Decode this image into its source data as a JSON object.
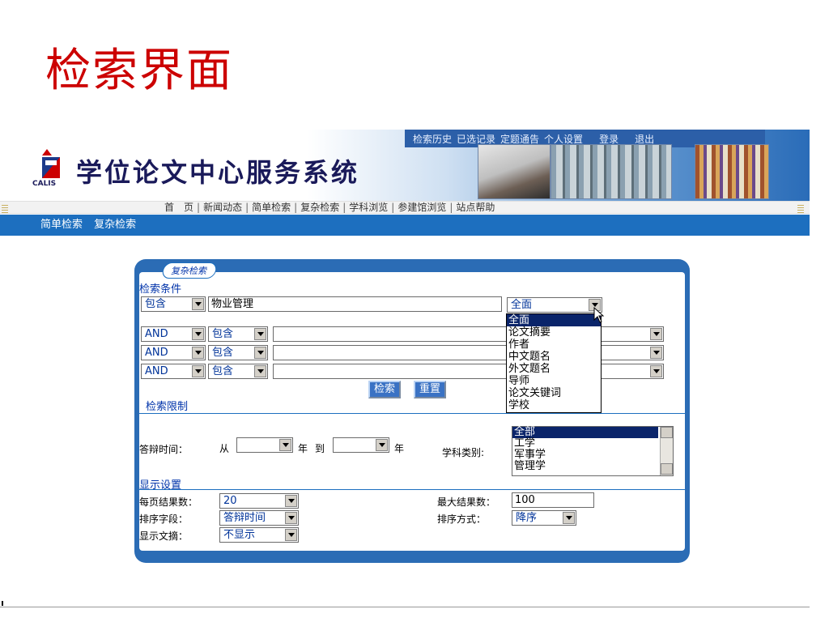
{
  "slide": {
    "title": "检索界面"
  },
  "header": {
    "logo_text": "学位论文中心服务系统",
    "logo_sub": "CALIS",
    "top_links": [
      "检索历史",
      "已选记录",
      "定题通告",
      "个人设置",
      "登录",
      "退出"
    ]
  },
  "main_nav": [
    "首　页",
    "新闻动态",
    "简单检索",
    "复杂检索",
    "学科浏览",
    "参建馆浏览",
    "站点帮助"
  ],
  "sub_nav": [
    "简单检索",
    "复杂检索"
  ],
  "panel": {
    "tab_label": "复杂检索",
    "conditions_label": "检索条件",
    "row1": {
      "match": "包含",
      "term": "物业管理",
      "field": "全面"
    },
    "rows": [
      {
        "logic": "AND",
        "match": "包含",
        "term": ""
      },
      {
        "logic": "AND",
        "match": "包含",
        "term": ""
      },
      {
        "logic": "AND",
        "match": "包含",
        "term": ""
      }
    ],
    "field_options": [
      "全面",
      "论文摘要",
      "作者",
      "中文题名",
      "外文题名",
      "导师",
      "论文关键词",
      "学校"
    ],
    "search_button": "检索",
    "reset_button": "重置",
    "limits_label": "检索限制",
    "defense_time_label": "答辩时间：",
    "from_label": "从",
    "year_label": "年",
    "to_label": "到",
    "from_year": "",
    "to_year": "",
    "subject_label": "学科类别:",
    "subject_options": [
      "全部",
      "工学",
      "军事学",
      "管理学"
    ],
    "display_label": "显示设置",
    "per_page_label": "每页结果数：",
    "per_page_value": "20",
    "max_results_label": "最大结果数：",
    "max_results_value": "100",
    "sort_field_label": "排序字段：",
    "sort_field_value": "答辩时间",
    "sort_order_label": "排序方式：",
    "sort_order_value": "降序",
    "abstract_label": "显示文摘：",
    "abstract_value": "不显示"
  }
}
